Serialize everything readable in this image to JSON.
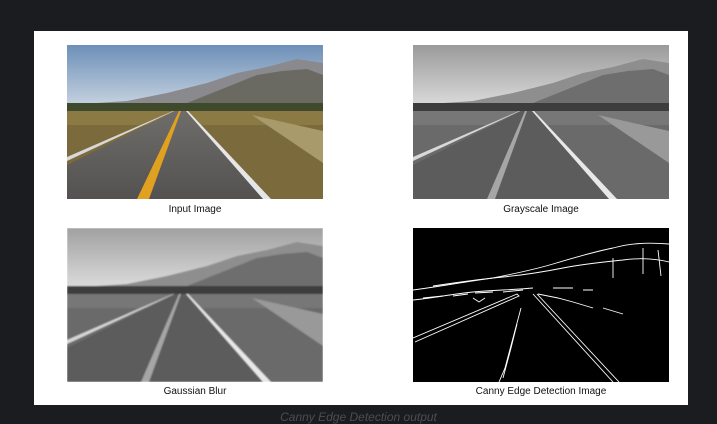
{
  "panels": [
    {
      "caption": "Input Image"
    },
    {
      "caption": "Grayscale Image"
    },
    {
      "caption": "Gaussian Blur"
    },
    {
      "caption": "Canny Edge Detection Image"
    }
  ],
  "bottom_caption": "Canny Edge Detection output",
  "colors": {
    "page_background": "#1b1c1f",
    "figure_background": "#ffffff",
    "center_line": "#e0a020",
    "edge_background": "#000000",
    "edge_lines": "#ffffff"
  }
}
